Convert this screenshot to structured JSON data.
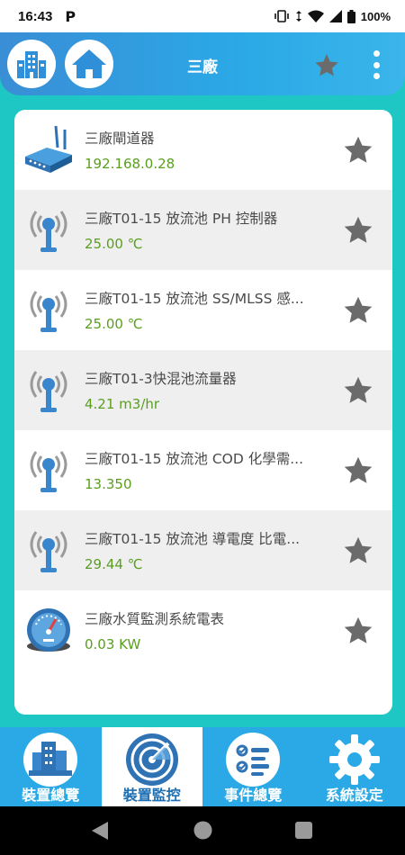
{
  "status_bar": {
    "time": "16:43",
    "app_letter": "P",
    "battery": "100%"
  },
  "header": {
    "title": "三廠"
  },
  "devices": [
    {
      "name": "三廠閘道器",
      "value": "192.168.0.28",
      "icon": "router-icon"
    },
    {
      "name": "三廠T01-15 放流池  PH 控制器",
      "value": "25.00 ℃",
      "icon": "sensor-antenna-icon"
    },
    {
      "name": "三廠T01-15 放流池 SS/MLSS 感...",
      "value": "25.00 ℃",
      "icon": "sensor-antenna-icon"
    },
    {
      "name": "三廠T01-3快混池流量器",
      "value": "4.21 m3/hr",
      "icon": "sensor-antenna-icon"
    },
    {
      "name": "三廠T01-15 放流池  COD 化學需...",
      "value": "13.350",
      "icon": "sensor-antenna-icon"
    },
    {
      "name": "三廠T01-15 放流池 導電度 比電...",
      "value": "29.44 ℃",
      "icon": "sensor-antenna-icon"
    },
    {
      "name": "三廠水質監測系統電表",
      "value": "0.03  KW",
      "icon": "power-meter-gauge-icon"
    }
  ],
  "bottom_nav": [
    {
      "label": "裝置總覽",
      "icon": "city-overview-icon",
      "active": false
    },
    {
      "label": "裝置監控",
      "icon": "radar-icon",
      "active": true
    },
    {
      "label": "事件總覽",
      "icon": "checklist-icon",
      "active": false
    },
    {
      "label": "系統設定",
      "icon": "gear-icon",
      "active": false
    }
  ],
  "colors": {
    "accent_teal": "#1ec7c3",
    "header_blue": "#2aa9e6",
    "value_green": "#5a9e1f",
    "star_gray": "#6b6b6b"
  }
}
